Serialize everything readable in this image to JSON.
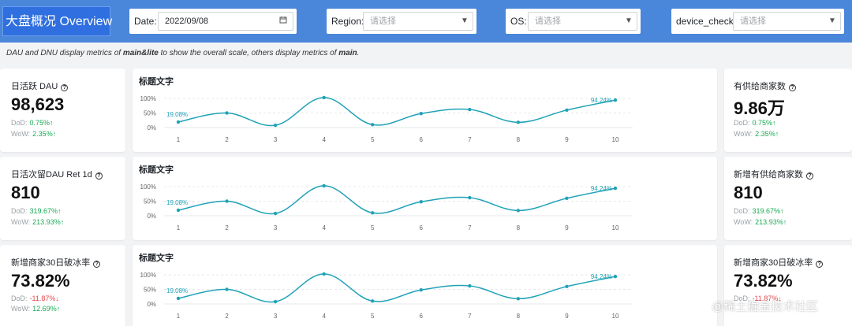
{
  "header": {
    "title": "大盘概况 Overview",
    "filters": {
      "date": {
        "label": "Date:",
        "value": "2022/09/08"
      },
      "region": {
        "label": "Region:",
        "placeholder": "请选择"
      },
      "os": {
        "label": "OS:",
        "placeholder": "请选择"
      },
      "device_check": {
        "label": "device_check:",
        "placeholder": "请选择"
      }
    }
  },
  "note": {
    "part1": "DAU and DNU display metrics of ",
    "bold1": "main&lite",
    "part2": " to show the overall scale, others display metrics of ",
    "bold2": "main",
    "part3": "."
  },
  "left_cards": [
    {
      "title": "日活跃 DAU",
      "value": "98,623",
      "dod_label": "DoD:",
      "dod": "0.75%",
      "dod_dir": "up",
      "wow_label": "WoW:",
      "wow": "2.35%",
      "wow_dir": "up"
    },
    {
      "title": "日活次留DAU Ret 1d",
      "value": "810",
      "dod_label": "DoD:",
      "dod": "319.67%",
      "dod_dir": "up",
      "wow_label": "WoW:",
      "wow": "213.93%",
      "wow_dir": "up"
    },
    {
      "title": "新增商家30日破冰率",
      "value": "73.82%",
      "dod_label": "DoD:",
      "dod": "-11.87%",
      "dod_dir": "down",
      "wow_label": "WoW:",
      "wow": "12.69%",
      "wow_dir": "up"
    }
  ],
  "right_cards": [
    {
      "title": "有供给商家数",
      "value": "9.86万",
      "dod_label": "DoD:",
      "dod": "0.75%",
      "dod_dir": "up",
      "wow_label": "WoW:",
      "wow": "2.35%",
      "wow_dir": "up"
    },
    {
      "title": "新增有供给商家数",
      "value": "810",
      "dod_label": "DoD:",
      "dod": "319.67%",
      "dod_dir": "up",
      "wow_label": "WoW:",
      "wow": "213.93%",
      "wow_dir": "up"
    },
    {
      "title": "新增商家30日破冰率",
      "value": "73.82%",
      "dod_label": "DoD:",
      "dod": "-11.87%",
      "dod_dir": "down"
    }
  ],
  "icons": {
    "help": "question-circle-icon",
    "date": "calendar-icon",
    "select": "caret-down-icon",
    "up": "arrow-up-icon",
    "down": "arrow-down-icon"
  },
  "arrows": {
    "up": "↑",
    "down": "↓"
  },
  "colors": {
    "header_bg": "#4a86d9",
    "brand_bg": "#2f6fe0",
    "line": "#1fa2b8",
    "up": "#1aaa55",
    "down": "#e5484d"
  },
  "watermark": "@稀土掘金技术社区",
  "chart_data": [
    {
      "type": "line",
      "title": "标题文字",
      "x": [
        1,
        2,
        3,
        4,
        5,
        6,
        7,
        8,
        9,
        10
      ],
      "y_ticks": [
        "100%",
        "50%",
        "0%"
      ],
      "ylim": [
        0,
        100
      ],
      "series": [
        {
          "values": [
            19.08,
            50,
            8,
            103,
            10,
            48,
            62,
            18,
            60,
            94.24
          ]
        }
      ],
      "annotations": [
        "19.08%",
        "94.24%"
      ],
      "grid": true
    },
    {
      "type": "line",
      "title": "标题文字",
      "x": [
        1,
        2,
        3,
        4,
        5,
        6,
        7,
        8,
        9,
        10
      ],
      "y_ticks": [
        "100%",
        "50%",
        "0%"
      ],
      "ylim": [
        0,
        100
      ],
      "series": [
        {
          "values": [
            19.08,
            50,
            8,
            103,
            10,
            48,
            62,
            18,
            60,
            94.24
          ]
        }
      ],
      "annotations": [
        "19.08%",
        "94.24%"
      ],
      "grid": true
    },
    {
      "type": "line",
      "title": "标题文字",
      "x": [
        1,
        2,
        3,
        4,
        5,
        6,
        7,
        8,
        9,
        10
      ],
      "y_ticks": [
        "100%",
        "50%",
        "0%"
      ],
      "ylim": [
        0,
        100
      ],
      "series": [
        {
          "values": [
            19.08,
            50,
            8,
            103,
            10,
            48,
            62,
            18,
            60,
            94.24
          ]
        }
      ],
      "annotations": [
        "19.08%",
        "94.24%"
      ],
      "grid": true
    }
  ]
}
